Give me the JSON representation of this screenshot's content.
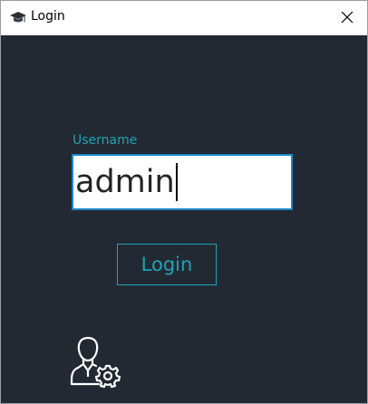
{
  "window": {
    "title": "Login",
    "app_icon": "graduation-cap-icon",
    "close_icon": "close-icon"
  },
  "form": {
    "username_label": "Username",
    "username_value": "admin",
    "login_label": "Login",
    "admin_icon": "user-settings-icon"
  },
  "colors": {
    "background": "#232932",
    "accent": "#1fa3b6",
    "input_border": "#1e88c8",
    "titlebar": "#ffffff"
  }
}
